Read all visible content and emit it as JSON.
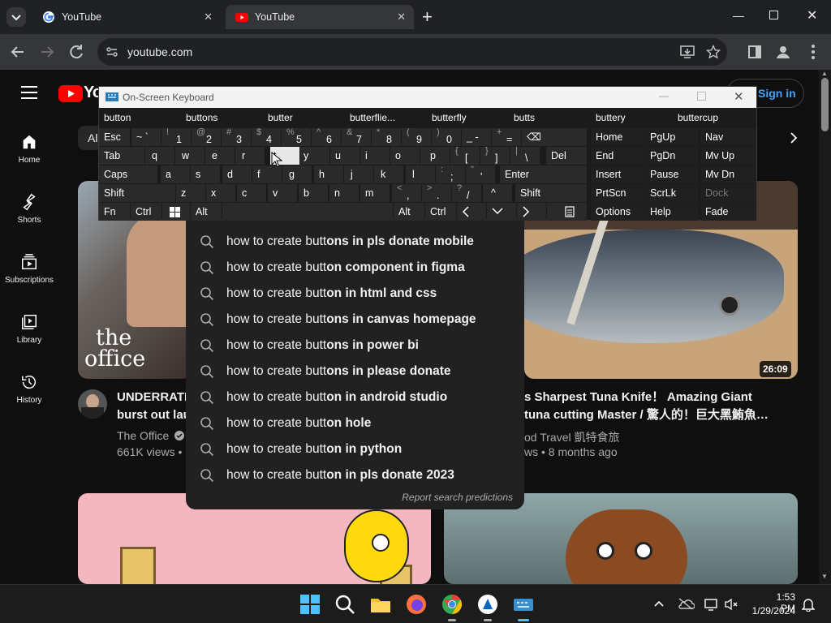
{
  "browser": {
    "tabs": [
      {
        "title": "YouTube",
        "active": false
      },
      {
        "title": "YouTube",
        "active": true
      }
    ],
    "new_tab_label": "+",
    "url": "youtube.com"
  },
  "youtube": {
    "logo_text": "Yo",
    "sign_in": "Sign in",
    "chip_first": "Al",
    "sidebar": [
      {
        "label": "Home",
        "icon": "home-icon"
      },
      {
        "label": "Shorts",
        "icon": "shorts-icon"
      },
      {
        "label": "Subscriptions",
        "icon": "subscriptions-icon"
      },
      {
        "label": "Library",
        "icon": "library-icon"
      },
      {
        "label": "History",
        "icon": "history-icon"
      }
    ],
    "videos": [
      {
        "title_line1": "UNDERRATE",
        "title_line2": "burst out lau",
        "channel": "The Office",
        "meta": "661K views •",
        "thumb_text_1": "the",
        "thumb_text_2": "office"
      },
      {
        "title_line1": "s Sharpest Tuna Knife！ Amazing Giant",
        "title_line2": "tuna cutting Master / 驚人的！巨大黑鮪魚…",
        "channel": "od Travel 凱特食旅",
        "meta": "ws • 8 months ago",
        "duration": "26:09"
      }
    ]
  },
  "suggestions": {
    "items": [
      {
        "typed": "how to create butt",
        "rest": "ons in pls donate mobile"
      },
      {
        "typed": "how to create butt",
        "rest": "on component in figma"
      },
      {
        "typed": "how to create butt",
        "rest": "on in html and css"
      },
      {
        "typed": "how to create butt",
        "rest": "ons in canvas homepage"
      },
      {
        "typed": "how to create butt",
        "rest": "ons in power bi"
      },
      {
        "typed": "how to create butt",
        "rest": "ons in please donate"
      },
      {
        "typed": "how to create butt",
        "rest": "on in android studio"
      },
      {
        "typed": "how to create butt",
        "rest": "on hole"
      },
      {
        "typed": "how to create butt",
        "rest": "on in python"
      },
      {
        "typed": "how to create butt",
        "rest": "on in pls donate 2023"
      }
    ],
    "report": "Report search predictions"
  },
  "keyboard": {
    "title": "On-Screen Keyboard",
    "predictions": [
      "button",
      "buttons",
      "butter",
      "butterflie...",
      "butterfly",
      "butts",
      "buttery",
      "buttercup"
    ],
    "row1": {
      "esc": "Esc",
      "keys": [
        [
          "~",
          "`"
        ],
        [
          "!",
          "1"
        ],
        [
          "@",
          "2"
        ],
        [
          "#",
          "3"
        ],
        [
          "$",
          "4"
        ],
        [
          "%",
          "5"
        ],
        [
          "^",
          "6"
        ],
        [
          "&",
          "7"
        ],
        [
          "*",
          "8"
        ],
        [
          "(",
          "9"
        ],
        [
          ")",
          "0"
        ],
        [
          "_",
          "-"
        ],
        [
          "+",
          "="
        ]
      ],
      "backspace": "⌫"
    },
    "row2": {
      "tab": "Tab",
      "keys": [
        "q",
        "w",
        "e",
        "r",
        "t",
        "y",
        "u",
        "i",
        "o",
        "p"
      ],
      "brackets": [
        [
          "{",
          "["
        ],
        [
          "}",
          "]"
        ],
        [
          "|",
          "\\"
        ]
      ],
      "del": "Del"
    },
    "row3": {
      "caps": "Caps",
      "keys": [
        "a",
        "s",
        "d",
        "f",
        "g",
        "h",
        "j",
        "k",
        "l"
      ],
      "punct": [
        [
          ":",
          ";"
        ],
        [
          "\"",
          "'"
        ]
      ],
      "enter": "Enter"
    },
    "row4": {
      "shift": "Shift",
      "keys": [
        "z",
        "x",
        "c",
        "v",
        "b",
        "n",
        "m"
      ],
      "punct": [
        [
          "<",
          ","
        ],
        [
          ">",
          "."
        ],
        [
          "?",
          "/"
        ]
      ],
      "up": "^",
      "shift_right": "Shift"
    },
    "row5": {
      "fn": "Fn",
      "ctrl": "Ctrl",
      "alt": "Alt",
      "alt_right": "Alt",
      "ctrl_right": "Ctrl"
    },
    "nav_keys": [
      [
        "Home",
        "PgUp",
        "Nav"
      ],
      [
        "End",
        "PgDn",
        "Mv Up"
      ],
      [
        "Insert",
        "Pause",
        "Mv Dn"
      ],
      [
        "PrtScn",
        "ScrLk",
        "Dock"
      ],
      [
        "Options",
        "Help",
        "Fade"
      ]
    ]
  },
  "taskbar": {
    "time": "1:53 PM",
    "date": "1/29/2024"
  },
  "colors": {
    "youtube_red": "#ff0000",
    "chrome_dark": "#202124",
    "sign_in_blue": "#3ea6ff"
  }
}
